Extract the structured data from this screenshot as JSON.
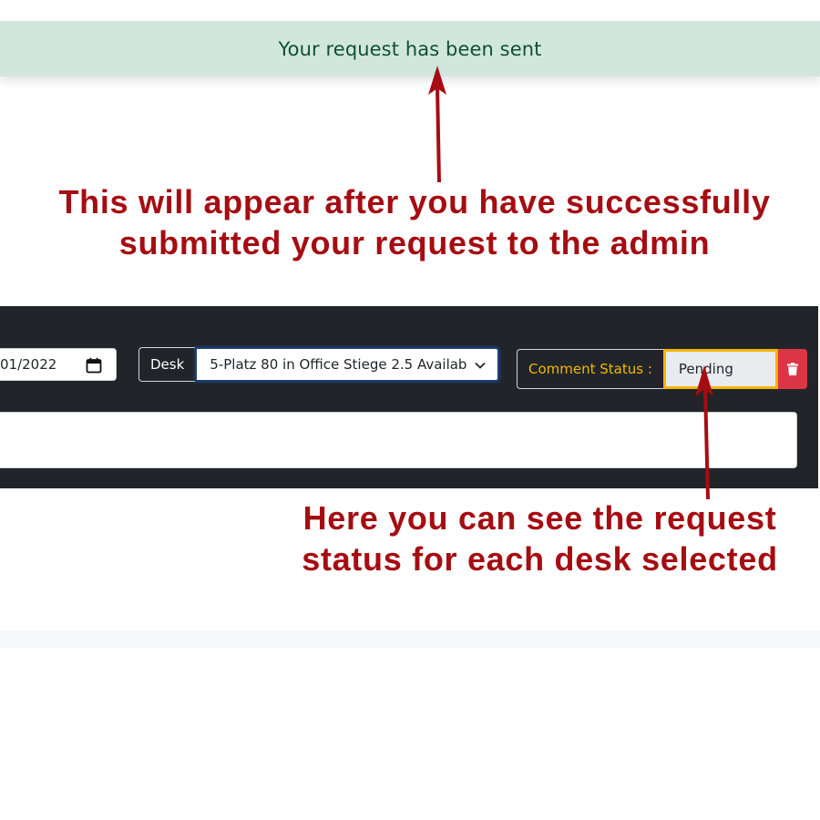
{
  "alert": {
    "message": "Your request has been sent"
  },
  "annotations": {
    "top": [
      "This will appear after you have successfully",
      "submitted your request to the admin"
    ],
    "bottom": [
      "Here you can see the request",
      "status for each desk selected"
    ]
  },
  "form": {
    "date_value": "01/2022",
    "desk_label": "Desk",
    "desk_selected": "5-Platz 80 in Office Stiege 2.5     Availab",
    "status_label": "Comment Status :",
    "status_value": "Pending",
    "comment_value": ""
  },
  "icons": {
    "calendar": "calendar-icon",
    "chevron": "chevron-down-icon",
    "delete": "trash-icon",
    "arrow": "arrow-up-icon"
  },
  "colors": {
    "alert_bg": "#d1e7dd",
    "alert_text": "#0f5132",
    "annotation": "#a50d12",
    "panel_bg": "#212529",
    "status_label": "#f2b705",
    "status_border": "#f4b400",
    "delete_bg": "#dc3545"
  }
}
